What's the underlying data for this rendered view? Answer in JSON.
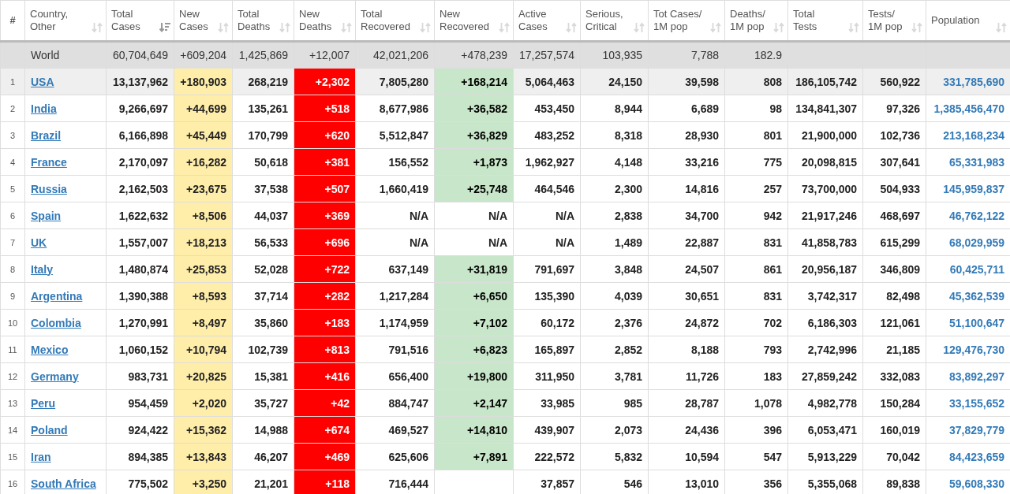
{
  "table": {
    "columns": [
      {
        "label": "#",
        "kind": "rank"
      },
      {
        "label": "Country,\nOther",
        "kind": "country",
        "sorted": false
      },
      {
        "label": "Total\nCases",
        "kind": "plain",
        "sorted": true
      },
      {
        "label": "New\nCases",
        "kind": "new_cases",
        "sorted": false
      },
      {
        "label": "Total\nDeaths",
        "kind": "plain",
        "sorted": false
      },
      {
        "label": "New\nDeaths",
        "kind": "new_deaths",
        "sorted": false
      },
      {
        "label": "Total\nRecovered",
        "kind": "plain",
        "sorted": false
      },
      {
        "label": "New\nRecovered",
        "kind": "new_recovered",
        "sorted": false
      },
      {
        "label": "Active\nCases",
        "kind": "plain",
        "sorted": false
      },
      {
        "label": "Serious,\nCritical",
        "kind": "plain",
        "sorted": false
      },
      {
        "label": "Tot Cases/\n1M pop",
        "kind": "plain",
        "sorted": false
      },
      {
        "label": "Deaths/\n1M pop",
        "kind": "plain",
        "sorted": false
      },
      {
        "label": "Total\nTests",
        "kind": "plain",
        "sorted": false
      },
      {
        "label": "Tests/\n1M pop",
        "kind": "plain",
        "sorted": false
      },
      {
        "label": "Population",
        "kind": "population",
        "sorted": false
      }
    ],
    "rows": [
      {
        "kind": "total",
        "highlighted": false,
        "cells": [
          "",
          "World",
          "60,704,649",
          "+609,204",
          "1,425,869",
          "+12,007",
          "42,021,206",
          "+478,239",
          "17,257,574",
          "103,935",
          "7,788",
          "182.9",
          "",
          "",
          ""
        ]
      },
      {
        "kind": "country",
        "highlighted": true,
        "recovered_highlighted": true,
        "cells": [
          "1",
          "USA",
          "13,137,962",
          "+180,903",
          "268,219",
          "+2,302",
          "7,805,280",
          "+168,214",
          "5,064,463",
          "24,150",
          "39,598",
          "808",
          "186,105,742",
          "560,922",
          "331,785,690"
        ]
      },
      {
        "kind": "country",
        "highlighted": false,
        "recovered_highlighted": true,
        "cells": [
          "2",
          "India",
          "9,266,697",
          "+44,699",
          "135,261",
          "+518",
          "8,677,986",
          "+36,582",
          "453,450",
          "8,944",
          "6,689",
          "98",
          "134,841,307",
          "97,326",
          "1,385,456,470"
        ]
      },
      {
        "kind": "country",
        "highlighted": false,
        "recovered_highlighted": true,
        "cells": [
          "3",
          "Brazil",
          "6,166,898",
          "+45,449",
          "170,799",
          "+620",
          "5,512,847",
          "+36,829",
          "483,252",
          "8,318",
          "28,930",
          "801",
          "21,900,000",
          "102,736",
          "213,168,234"
        ]
      },
      {
        "kind": "country",
        "highlighted": false,
        "recovered_highlighted": true,
        "cells": [
          "4",
          "France",
          "2,170,097",
          "+16,282",
          "50,618",
          "+381",
          "156,552",
          "+1,873",
          "1,962,927",
          "4,148",
          "33,216",
          "775",
          "20,098,815",
          "307,641",
          "65,331,983"
        ]
      },
      {
        "kind": "country",
        "highlighted": false,
        "recovered_highlighted": true,
        "cells": [
          "5",
          "Russia",
          "2,162,503",
          "+23,675",
          "37,538",
          "+507",
          "1,660,419",
          "+25,748",
          "464,546",
          "2,300",
          "14,816",
          "257",
          "73,700,000",
          "504,933",
          "145,959,837"
        ]
      },
      {
        "kind": "country",
        "highlighted": false,
        "recovered_highlighted": false,
        "cells": [
          "6",
          "Spain",
          "1,622,632",
          "+8,506",
          "44,037",
          "+369",
          "N/A",
          "N/A",
          "N/A",
          "2,838",
          "34,700",
          "942",
          "21,917,246",
          "468,697",
          "46,762,122"
        ]
      },
      {
        "kind": "country",
        "highlighted": false,
        "recovered_highlighted": false,
        "cells": [
          "7",
          "UK",
          "1,557,007",
          "+18,213",
          "56,533",
          "+696",
          "N/A",
          "N/A",
          "N/A",
          "1,489",
          "22,887",
          "831",
          "41,858,783",
          "615,299",
          "68,029,959"
        ]
      },
      {
        "kind": "country",
        "highlighted": false,
        "recovered_highlighted": true,
        "cells": [
          "8",
          "Italy",
          "1,480,874",
          "+25,853",
          "52,028",
          "+722",
          "637,149",
          "+31,819",
          "791,697",
          "3,848",
          "24,507",
          "861",
          "20,956,187",
          "346,809",
          "60,425,711"
        ]
      },
      {
        "kind": "country",
        "highlighted": false,
        "recovered_highlighted": true,
        "cells": [
          "9",
          "Argentina",
          "1,390,388",
          "+8,593",
          "37,714",
          "+282",
          "1,217,284",
          "+6,650",
          "135,390",
          "4,039",
          "30,651",
          "831",
          "3,742,317",
          "82,498",
          "45,362,539"
        ]
      },
      {
        "kind": "country",
        "highlighted": false,
        "recovered_highlighted": true,
        "cells": [
          "10",
          "Colombia",
          "1,270,991",
          "+8,497",
          "35,860",
          "+183",
          "1,174,959",
          "+7,102",
          "60,172",
          "2,376",
          "24,872",
          "702",
          "6,186,303",
          "121,061",
          "51,100,647"
        ]
      },
      {
        "kind": "country",
        "highlighted": false,
        "recovered_highlighted": true,
        "cells": [
          "11",
          "Mexico",
          "1,060,152",
          "+10,794",
          "102,739",
          "+813",
          "791,516",
          "+6,823",
          "165,897",
          "2,852",
          "8,188",
          "793",
          "2,742,996",
          "21,185",
          "129,476,730"
        ]
      },
      {
        "kind": "country",
        "highlighted": false,
        "recovered_highlighted": true,
        "cells": [
          "12",
          "Germany",
          "983,731",
          "+20,825",
          "15,381",
          "+416",
          "656,400",
          "+19,800",
          "311,950",
          "3,781",
          "11,726",
          "183",
          "27,859,242",
          "332,083",
          "83,892,297"
        ]
      },
      {
        "kind": "country",
        "highlighted": false,
        "recovered_highlighted": true,
        "cells": [
          "13",
          "Peru",
          "954,459",
          "+2,020",
          "35,727",
          "+42",
          "884,747",
          "+2,147",
          "33,985",
          "985",
          "28,787",
          "1,078",
          "4,982,778",
          "150,284",
          "33,155,652"
        ]
      },
      {
        "kind": "country",
        "highlighted": false,
        "recovered_highlighted": true,
        "cells": [
          "14",
          "Poland",
          "924,422",
          "+15,362",
          "14,988",
          "+674",
          "469,527",
          "+14,810",
          "439,907",
          "2,073",
          "24,436",
          "396",
          "6,053,471",
          "160,019",
          "37,829,779"
        ]
      },
      {
        "kind": "country",
        "highlighted": false,
        "recovered_highlighted": true,
        "cells": [
          "15",
          "Iran",
          "894,385",
          "+13,843",
          "46,207",
          "+469",
          "625,606",
          "+7,891",
          "222,572",
          "5,832",
          "10,594",
          "547",
          "5,913,229",
          "70,042",
          "84,423,659"
        ]
      },
      {
        "kind": "country",
        "highlighted": false,
        "cells": [
          "16",
          "South Africa",
          "775,502",
          "+3,250",
          "21,201",
          "+118",
          "716,444",
          "",
          "37,857",
          "546",
          "13,010",
          "356",
          "5,355,068",
          "89,838",
          "59,608,330"
        ]
      }
    ]
  }
}
